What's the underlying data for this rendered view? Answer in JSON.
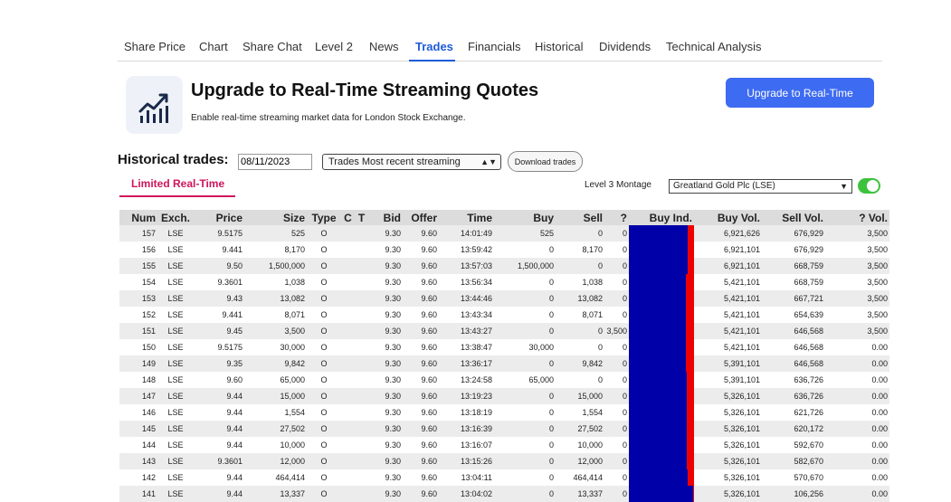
{
  "tabs": [
    "Share Price",
    "Chart",
    "Share Chat",
    "Level 2",
    "News",
    "Trades",
    "Financials",
    "Historical",
    "Dividends",
    "Technical Analysis"
  ],
  "active_tab": "Trades",
  "promo": {
    "title": "Upgrade to Real-Time Streaming Quotes",
    "subtitle": "Enable real-time streaming market data for London Stock Exchange.",
    "button": "Upgrade to Real-Time"
  },
  "controls": {
    "historical_label": "Historical trades:",
    "date_value": "08/11/2023",
    "trade_select": "Trades Most recent streaming",
    "download_label": "Download trades",
    "limited_label": "Limited Real-Time",
    "montage_label": "Level 3 Montage",
    "montage_select": "Greatland Gold Plc (LSE)",
    "toggle_on": true
  },
  "table": {
    "columns": [
      "Num",
      "Exch.",
      "Price",
      "Size",
      "Type",
      "C",
      "T",
      "Bid",
      "Offer",
      "Time",
      "Buy",
      "Sell",
      "?",
      "Buy Ind.",
      "Buy Vol.",
      "Sell Vol.",
      "? Vol."
    ],
    "rows": [
      {
        "num": "157",
        "exch": "LSE",
        "price": "9.5175",
        "size": "525",
        "type": "O",
        "c": "",
        "t": "",
        "bid": "9.30",
        "offer": "9.60",
        "time": "14:01:49",
        "buy": "525",
        "sell": "0",
        "q": "0",
        "red": 0.1,
        "buyvol": "6,921,626",
        "sellvol": "676,929",
        "qvol": "3,500"
      },
      {
        "num": "156",
        "exch": "LSE",
        "price": "9.441",
        "size": "8,170",
        "type": "O",
        "c": "",
        "t": "",
        "bid": "9.30",
        "offer": "9.60",
        "time": "13:59:42",
        "buy": "0",
        "sell": "8,170",
        "q": "0",
        "red": 0.1,
        "buyvol": "6,921,101",
        "sellvol": "676,929",
        "qvol": "3,500"
      },
      {
        "num": "155",
        "exch": "LSE",
        "price": "9.50",
        "size": "1,500,000",
        "type": "O",
        "c": "",
        "t": "",
        "bid": "9.30",
        "offer": "9.60",
        "time": "13:57:03",
        "buy": "1,500,000",
        "sell": "0",
        "q": "0",
        "red": 0.1,
        "buyvol": "6,921,101",
        "sellvol": "668,759",
        "qvol": "3,500"
      },
      {
        "num": "154",
        "exch": "LSE",
        "price": "9.3601",
        "size": "1,038",
        "type": "O",
        "c": "",
        "t": "",
        "bid": "9.30",
        "offer": "9.60",
        "time": "13:56:34",
        "buy": "0",
        "sell": "1,038",
        "q": "0",
        "red": 0.12,
        "buyvol": "5,421,101",
        "sellvol": "668,759",
        "qvol": "3,500"
      },
      {
        "num": "153",
        "exch": "LSE",
        "price": "9.43",
        "size": "13,082",
        "type": "O",
        "c": "",
        "t": "",
        "bid": "9.30",
        "offer": "9.60",
        "time": "13:44:46",
        "buy": "0",
        "sell": "13,082",
        "q": "0",
        "red": 0.12,
        "buyvol": "5,421,101",
        "sellvol": "667,721",
        "qvol": "3,500"
      },
      {
        "num": "152",
        "exch": "LSE",
        "price": "9.441",
        "size": "8,071",
        "type": "O",
        "c": "",
        "t": "",
        "bid": "9.30",
        "offer": "9.60",
        "time": "13:43:34",
        "buy": "0",
        "sell": "8,071",
        "q": "0",
        "red": 0.12,
        "buyvol": "5,421,101",
        "sellvol": "654,639",
        "qvol": "3,500"
      },
      {
        "num": "151",
        "exch": "LSE",
        "price": "9.45",
        "size": "3,500",
        "type": "O",
        "c": "",
        "t": "",
        "bid": "9.30",
        "offer": "9.60",
        "time": "13:43:27",
        "buy": "0",
        "sell": "0",
        "q": "3,500",
        "red": 0.12,
        "buyvol": "5,421,101",
        "sellvol": "646,568",
        "qvol": "3,500"
      },
      {
        "num": "150",
        "exch": "LSE",
        "price": "9.5175",
        "size": "30,000",
        "type": "O",
        "c": "",
        "t": "",
        "bid": "9.30",
        "offer": "9.60",
        "time": "13:38:47",
        "buy": "30,000",
        "sell": "0",
        "q": "0",
        "red": 0.12,
        "buyvol": "5,421,101",
        "sellvol": "646,568",
        "qvol": "0.00"
      },
      {
        "num": "149",
        "exch": "LSE",
        "price": "9.35",
        "size": "9,842",
        "type": "O",
        "c": "",
        "t": "",
        "bid": "9.30",
        "offer": "9.60",
        "time": "13:36:17",
        "buy": "0",
        "sell": "9,842",
        "q": "0",
        "red": 0.12,
        "buyvol": "5,391,101",
        "sellvol": "646,568",
        "qvol": "0.00"
      },
      {
        "num": "148",
        "exch": "LSE",
        "price": "9.60",
        "size": "65,000",
        "type": "O",
        "c": "",
        "t": "",
        "bid": "9.30",
        "offer": "9.60",
        "time": "13:24:58",
        "buy": "65,000",
        "sell": "0",
        "q": "0",
        "red": 0.11,
        "buyvol": "5,391,101",
        "sellvol": "636,726",
        "qvol": "0.00"
      },
      {
        "num": "147",
        "exch": "LSE",
        "price": "9.44",
        "size": "15,000",
        "type": "O",
        "c": "",
        "t": "",
        "bid": "9.30",
        "offer": "9.60",
        "time": "13:19:23",
        "buy": "0",
        "sell": "15,000",
        "q": "0",
        "red": 0.11,
        "buyvol": "5,326,101",
        "sellvol": "636,726",
        "qvol": "0.00"
      },
      {
        "num": "146",
        "exch": "LSE",
        "price": "9.44",
        "size": "1,554",
        "type": "O",
        "c": "",
        "t": "",
        "bid": "9.30",
        "offer": "9.60",
        "time": "13:18:19",
        "buy": "0",
        "sell": "1,554",
        "q": "0",
        "red": 0.11,
        "buyvol": "5,326,101",
        "sellvol": "621,726",
        "qvol": "0.00"
      },
      {
        "num": "145",
        "exch": "LSE",
        "price": "9.44",
        "size": "27,502",
        "type": "O",
        "c": "",
        "t": "",
        "bid": "9.30",
        "offer": "9.60",
        "time": "13:16:39",
        "buy": "0",
        "sell": "27,502",
        "q": "0",
        "red": 0.11,
        "buyvol": "5,326,101",
        "sellvol": "620,172",
        "qvol": "0.00"
      },
      {
        "num": "144",
        "exch": "LSE",
        "price": "9.44",
        "size": "10,000",
        "type": "O",
        "c": "",
        "t": "",
        "bid": "9.30",
        "offer": "9.60",
        "time": "13:16:07",
        "buy": "0",
        "sell": "10,000",
        "q": "0",
        "red": 0.11,
        "buyvol": "5,326,101",
        "sellvol": "592,670",
        "qvol": "0.00"
      },
      {
        "num": "143",
        "exch": "LSE",
        "price": "9.3601",
        "size": "12,000",
        "type": "O",
        "c": "",
        "t": "",
        "bid": "9.30",
        "offer": "9.60",
        "time": "13:15:26",
        "buy": "0",
        "sell": "12,000",
        "q": "0",
        "red": 0.11,
        "buyvol": "5,326,101",
        "sellvol": "582,670",
        "qvol": "0.00"
      },
      {
        "num": "142",
        "exch": "LSE",
        "price": "9.44",
        "size": "464,414",
        "type": "O",
        "c": "",
        "t": "",
        "bid": "9.30",
        "offer": "9.60",
        "time": "13:04:11",
        "buy": "0",
        "sell": "464,414",
        "q": "0",
        "red": 0.1,
        "buyvol": "5,326,101",
        "sellvol": "570,670",
        "qvol": "0.00"
      },
      {
        "num": "141",
        "exch": "LSE",
        "price": "9.44",
        "size": "13,337",
        "type": "O",
        "c": "",
        "t": "",
        "bid": "9.30",
        "offer": "9.60",
        "time": "13:04:02",
        "buy": "0",
        "sell": "13,337",
        "q": "0",
        "red": 0.02,
        "buyvol": "5,326,101",
        "sellvol": "106,256",
        "qvol": "0.00"
      }
    ]
  }
}
